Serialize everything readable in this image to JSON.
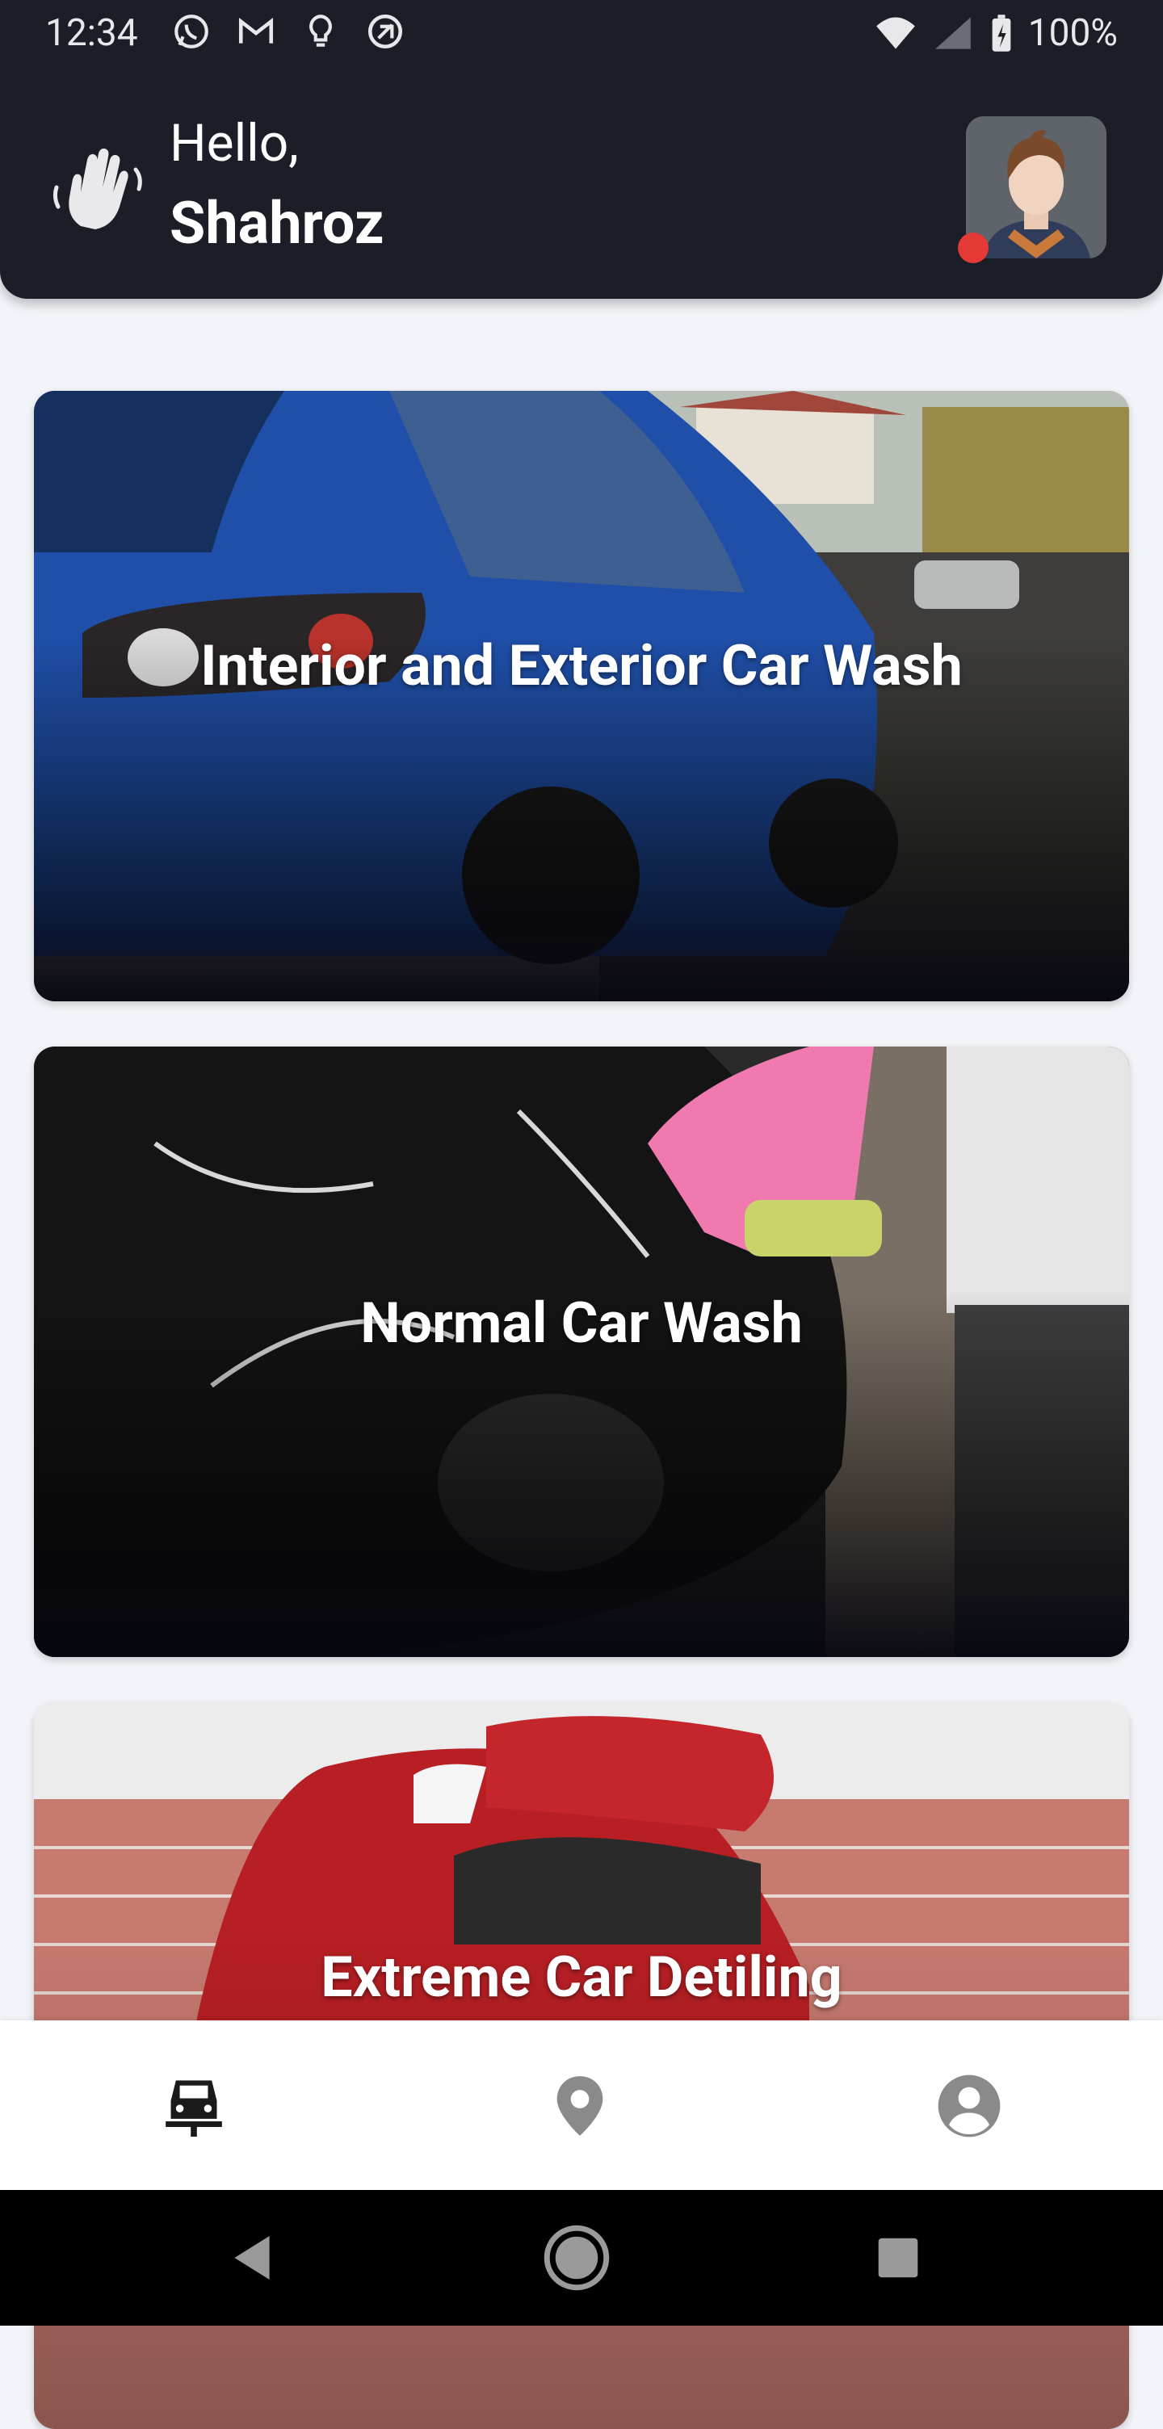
{
  "status_bar": {
    "time": "12:34",
    "battery": "100%",
    "left_icons": [
      "whatsapp-icon",
      "gmail-icon",
      "bulb-icon",
      "sync-icon"
    ],
    "right_icons": [
      "wifi-icon",
      "signal-icon",
      "battery-icon"
    ]
  },
  "header": {
    "greeting": "Hello,",
    "username": "Shahroz",
    "online_color": "#e53935"
  },
  "services": [
    {
      "title": "Interior and Exterior Car Wash"
    },
    {
      "title": "Normal Car Wash"
    },
    {
      "title": "Extreme Car Detiling"
    }
  ],
  "bottom_nav": {
    "items": [
      {
        "icon": "car-icon",
        "active": true
      },
      {
        "icon": "location-pin-icon",
        "active": false
      },
      {
        "icon": "account-icon",
        "active": false
      }
    ]
  },
  "system_nav": [
    "back-button",
    "home-button",
    "recents-button"
  ]
}
